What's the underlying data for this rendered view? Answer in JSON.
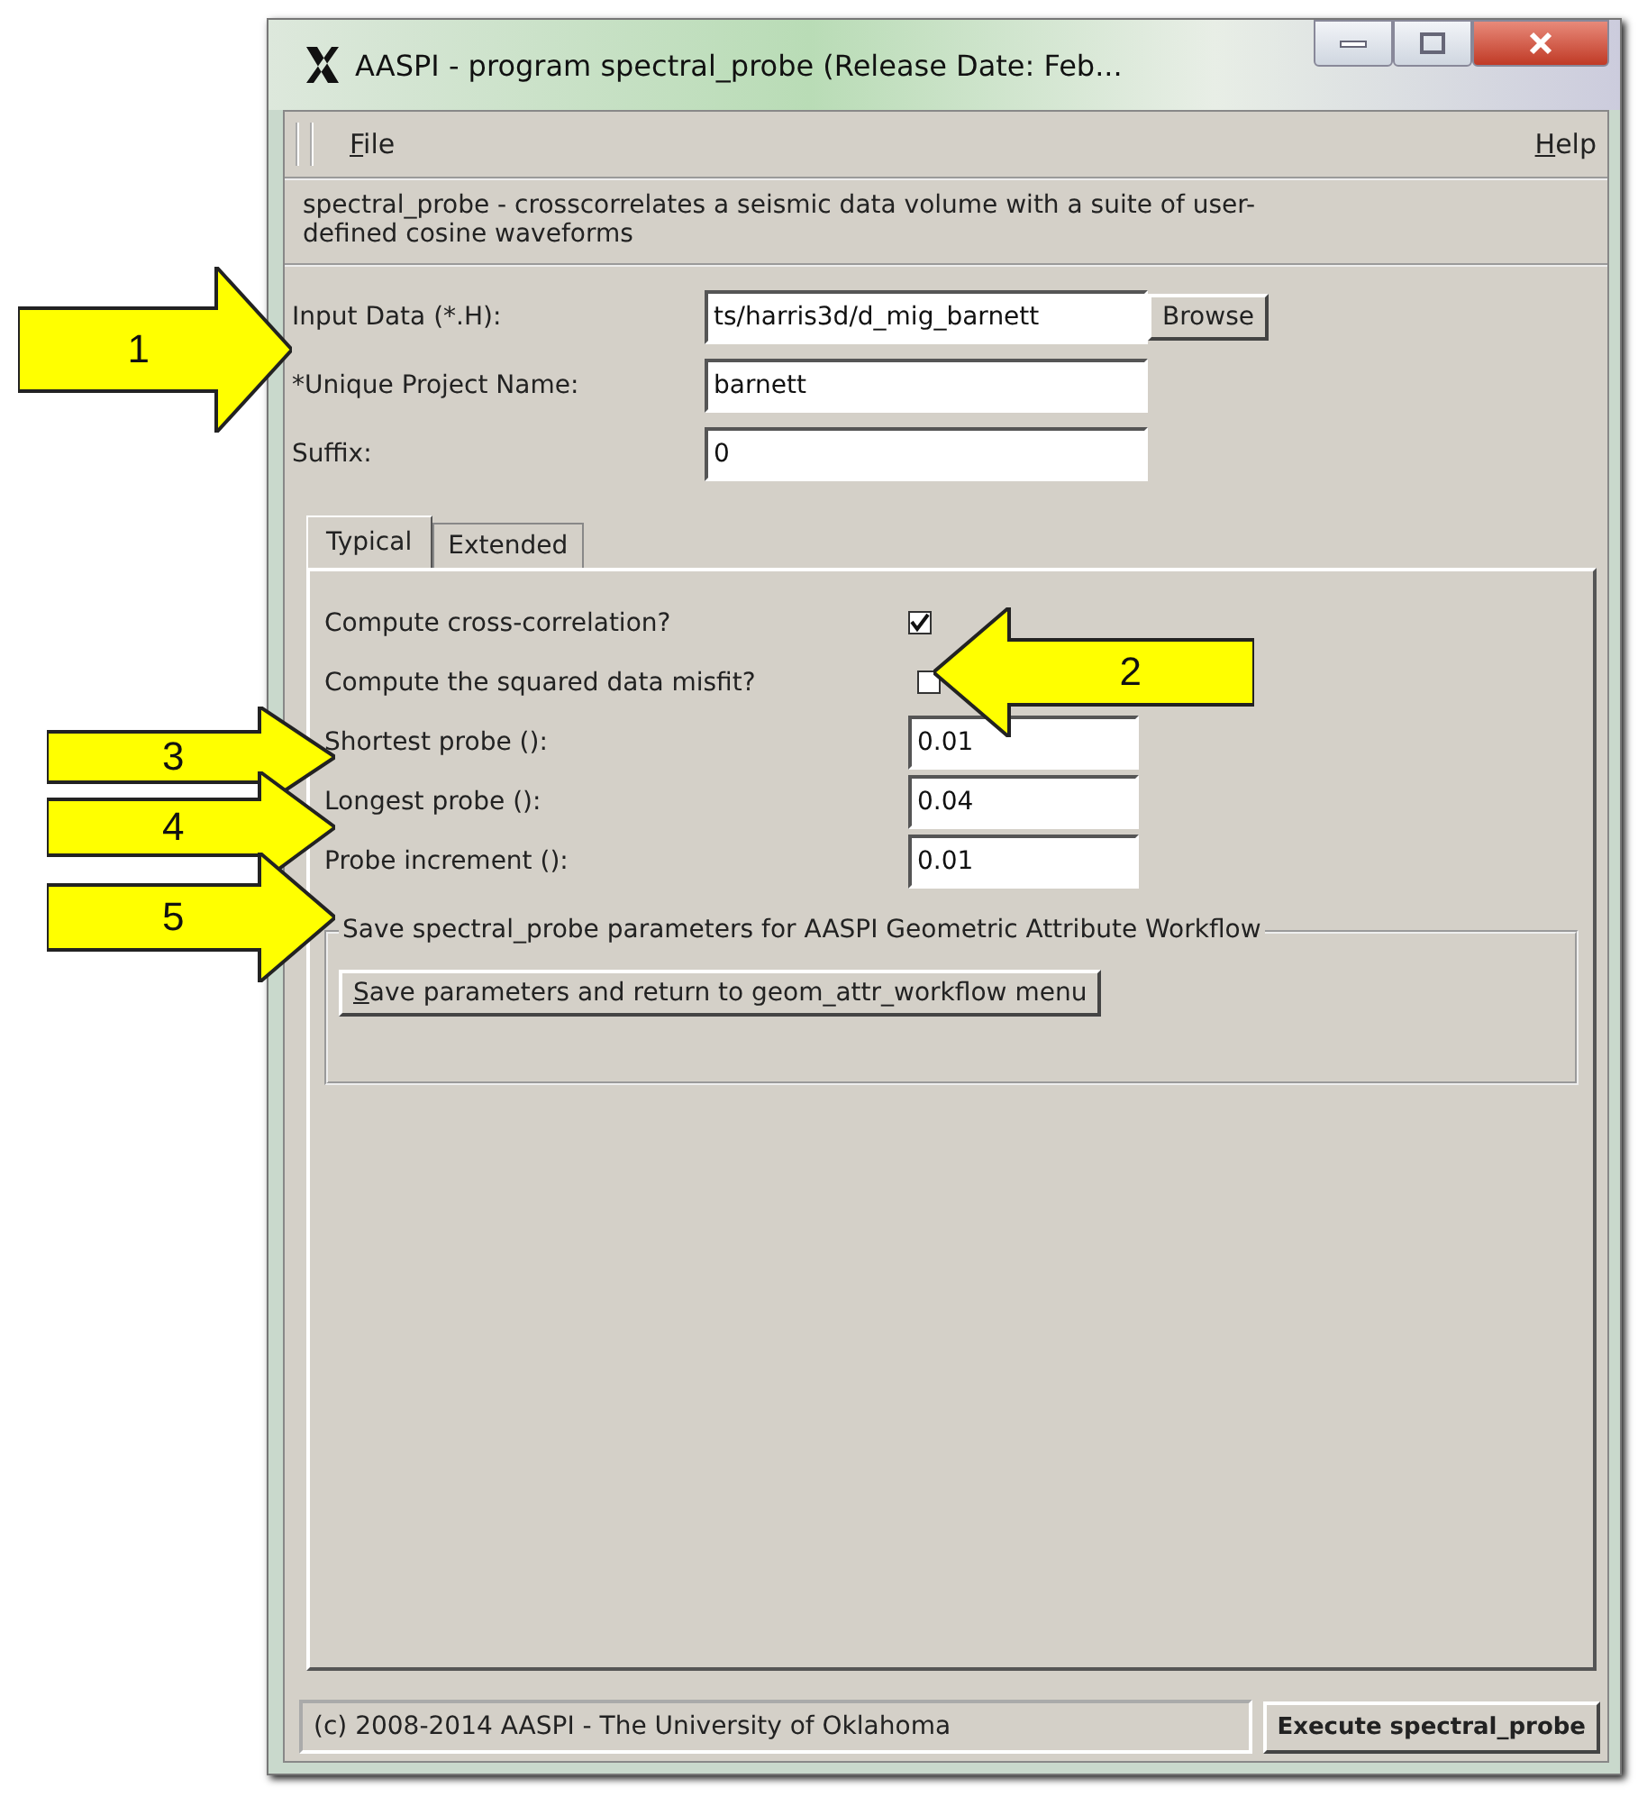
{
  "window": {
    "title": "AASPI - program spectral_probe (Release Date: Feb..."
  },
  "menu": [
    {
      "label": "File"
    },
    {
      "label": "Help"
    }
  ],
  "description": "spectral_probe - crosscorrelates a seismic data volume with a suite of user-defined cosine waveforms",
  "top_fields": [
    {
      "label": "Input Data (*.H):",
      "value": "ts/harris3d/d_mig_barnett",
      "button": "Browse"
    },
    {
      "label": "*Unique Project Name:",
      "value": "barnett"
    },
    {
      "label": "Suffix:",
      "value": "0"
    }
  ],
  "tabs": [
    {
      "label": "Typical",
      "selected": true
    },
    {
      "label": "Extended",
      "selected": false
    }
  ],
  "options": [
    {
      "kind": "checkbox",
      "label": "Compute cross-correlation?",
      "checked": true
    },
    {
      "kind": "checkbox",
      "label": "Compute the squared data misfit?",
      "checked": false
    },
    {
      "kind": "field",
      "label": "Shortest probe ():",
      "value": "0.01"
    },
    {
      "kind": "field",
      "label": "Longest probe ():",
      "value": "0.04"
    },
    {
      "kind": "field",
      "label": "Probe increment ():",
      "value": "0.01"
    }
  ],
  "group": {
    "title": "Save spectral_probe parameters for AASPI Geometric Attribute Workflow",
    "button": "Save parameters and return to geom_attr_workflow menu"
  },
  "status_bar": {
    "text": "(c) 2008-2014 AASPI - The University of Oklahoma",
    "button": "Execute spectral_probe"
  },
  "callouts": [
    {
      "number": "1",
      "kind": "right"
    },
    {
      "number": "2",
      "kind": "left"
    },
    {
      "number": "3",
      "kind": "right"
    },
    {
      "number": "4",
      "kind": "right"
    },
    {
      "number": "5",
      "kind": "right"
    }
  ]
}
